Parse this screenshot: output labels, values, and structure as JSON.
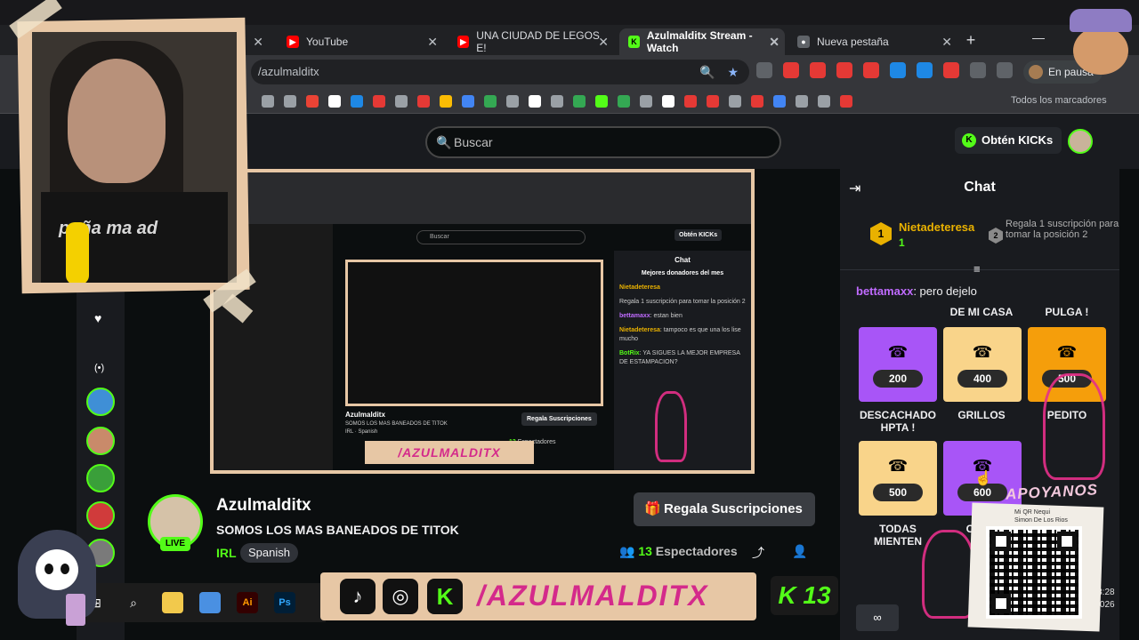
{
  "browser": {
    "tabs": [
      {
        "label": "YouTube",
        "color": "#ff0000"
      },
      {
        "label": "UNA CIUDAD DE LEGOS E!",
        "color": "#ff0000"
      },
      {
        "label": "Azulmalditx Stream - Watch",
        "color": "#53fc18"
      },
      {
        "label": "Nueva pestaña",
        "color": "#8ab4f8"
      }
    ],
    "url": "/azulmalditx",
    "profile_label": "En pausa",
    "bookmarks_all": "Todos los marcadores"
  },
  "kick": {
    "search_placeholder": "Buscar",
    "get_kicks": "Obtén KICKs"
  },
  "channel": {
    "name": "Azulmalditx",
    "title": "SOMOS LOS MAS BANEADOS DE TITOK",
    "category": "IRL",
    "language": "Spanish",
    "live_label": "LIVE",
    "gift_button": "Regala Suscripciones",
    "viewers_count": "13",
    "viewers_label": "Espectadores"
  },
  "chat": {
    "title": "Chat",
    "top_donor": {
      "rank": "1",
      "name": "Nietadeteresa",
      "count": "1"
    },
    "second_rank": "2",
    "second_message": "Regala 1 suscripción para tomar la posición 2",
    "message": {
      "user": "bettamaxx",
      "text": ": pero dejelo"
    },
    "tiles": [
      {
        "top_label": "DE MI CASA",
        "price": "200",
        "bottom_label": "DESCACHADO HPTA !"
      },
      {
        "top_label": "",
        "price": "400",
        "bottom_label": "GRILLOS"
      },
      {
        "top_label": "PULGA !",
        "price": "500",
        "bottom_label": "PEDITO"
      },
      {
        "top_label": "",
        "price": "500",
        "bottom_label": "TODAS MIENTEN"
      },
      {
        "top_label": "",
        "price": "600",
        "bottom_label": "CONV"
      }
    ],
    "footer_label": "∞"
  },
  "mini": {
    "chat_title": "Chat",
    "top_donors": "Mejores donadores del mes",
    "donor": "Nietadeteresa",
    "donor_note": "Regala 1 suscripción para tomar la posición 2",
    "msg1_user": "bettamaxx",
    "msg1_text": ": estan bien",
    "msg2_user": "Nietadeteresa",
    "msg2_text": ": tampoco es que una los lise mucho",
    "msg3_user": "BotRix",
    "msg3_text": ": YA SIGUES LA MEJOR EMPRESA DE ESTAMPACION?",
    "channel": "Azulmalditx",
    "channel_title": "SOMOS LOS MAS BANEADOS DE TITOK",
    "category": "IRL",
    "language": "Spanish",
    "gift": "Regala Suscripciones",
    "viewers_count": "13",
    "viewers_label": "Espectadores",
    "search": "Buscar",
    "kicks": "Obtén KICKs",
    "banner": "/AZULMALDITX"
  },
  "overlay": {
    "shirt_text": "poña ma ad",
    "banner_text": "/AZULMALDITX",
    "k13": "K 13",
    "qr_title": "APOYANOS",
    "qr_meta_1": "Mi QR Nequi",
    "qr_meta_2": "Simon De Los Rios",
    "clock_time": "3:28",
    "clock_date": "3/2026"
  }
}
